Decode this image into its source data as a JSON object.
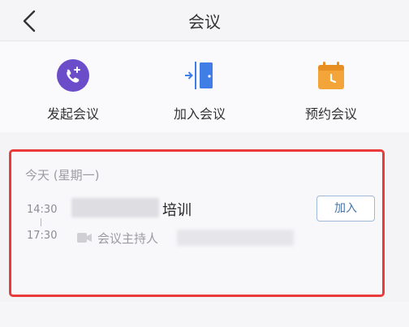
{
  "header": {
    "title": "会议",
    "back_icon": "chevron-left-icon"
  },
  "actions": [
    {
      "label": "发起会议",
      "icon": "phone-plus-icon",
      "color": "#6b4cc9"
    },
    {
      "label": "加入会议",
      "icon": "door-enter-icon",
      "color": "#3f7ee6"
    },
    {
      "label": "预约会议",
      "icon": "calendar-icon",
      "color": "#f3a53a"
    }
  ],
  "meetings": {
    "day_title": "今天 (星期一)",
    "items": [
      {
        "start_time": "14:30",
        "end_time": "17:30",
        "name_suffix": "培训",
        "host_label": "会议主持人",
        "join_label": "加入"
      }
    ]
  },
  "highlight_color": "#ea3b3b"
}
